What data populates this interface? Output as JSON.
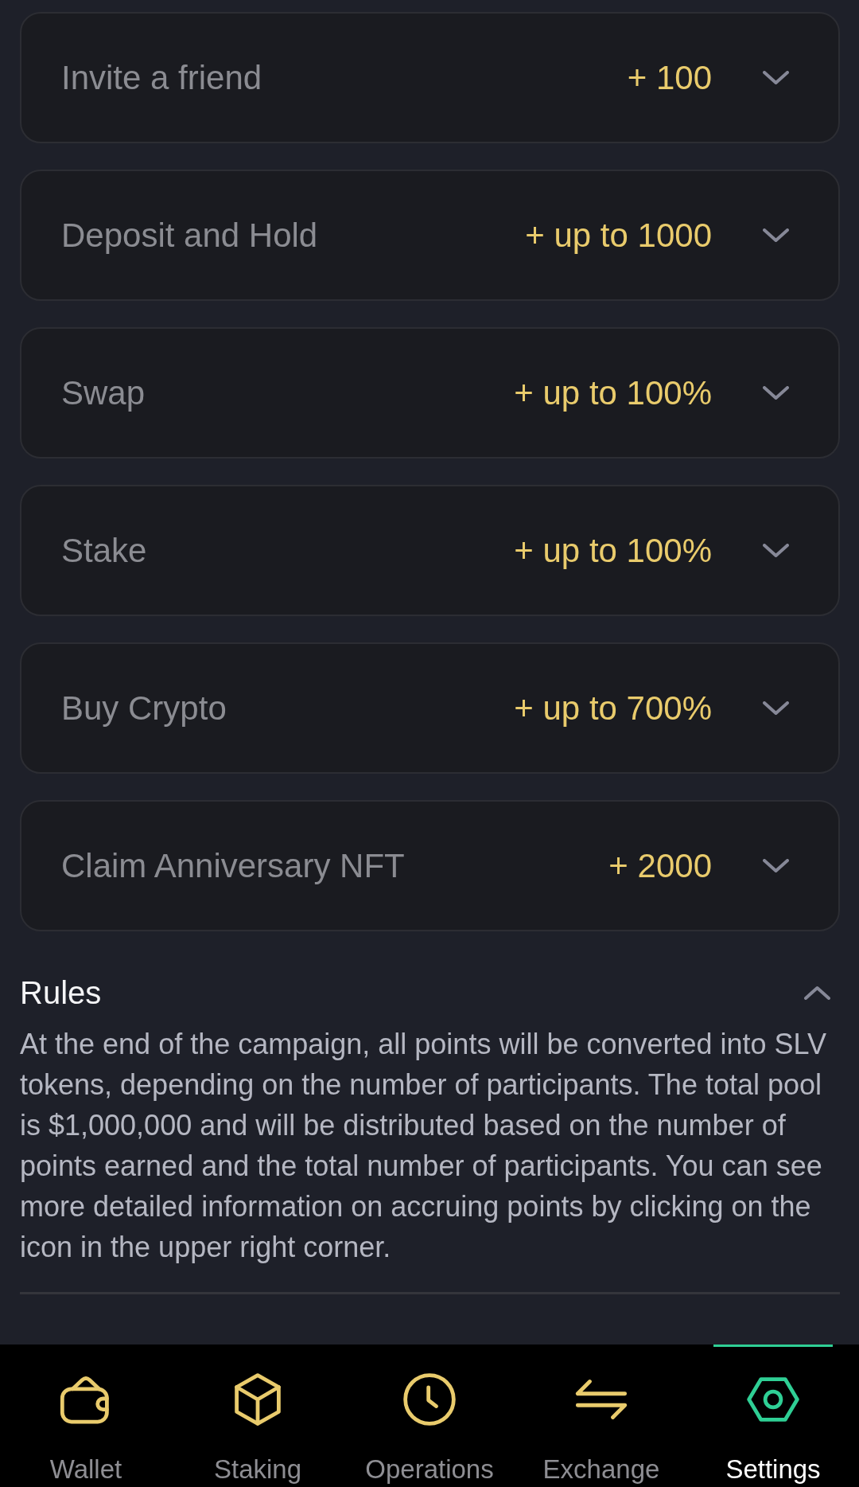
{
  "tasks": [
    {
      "label": "Invite a friend",
      "reward": "+ 100",
      "expanded": false
    },
    {
      "label": "Deposit and Hold",
      "reward": "+ up to 1000",
      "expanded": false
    },
    {
      "label": "Swap",
      "reward": "+ up to 100%",
      "expanded": false
    },
    {
      "label": "Stake",
      "reward": "+ up to 100%",
      "expanded": false
    },
    {
      "label": "Buy Crypto",
      "reward": "+ up to 700%",
      "expanded": false
    },
    {
      "label": "Claim Anniversary NFT",
      "reward": "+ 2000",
      "expanded": false
    }
  ],
  "rules": {
    "title": "Rules",
    "expanded": true,
    "text": "At the end of the campaign, all points will be converted into SLV tokens, depending on the number of participants. The total pool is $1,000,000 and will be distributed based on the number of points earned and the total number of participants. You can see more detailed information on accruing points by clicking on the icon in the upper right corner."
  },
  "bottom_nav": [
    {
      "label": "Wallet",
      "selected": false
    },
    {
      "label": "Staking",
      "selected": false
    },
    {
      "label": "Operations",
      "selected": false
    },
    {
      "label": "Exchange",
      "selected": false
    },
    {
      "label": "Settings",
      "selected": true
    }
  ]
}
